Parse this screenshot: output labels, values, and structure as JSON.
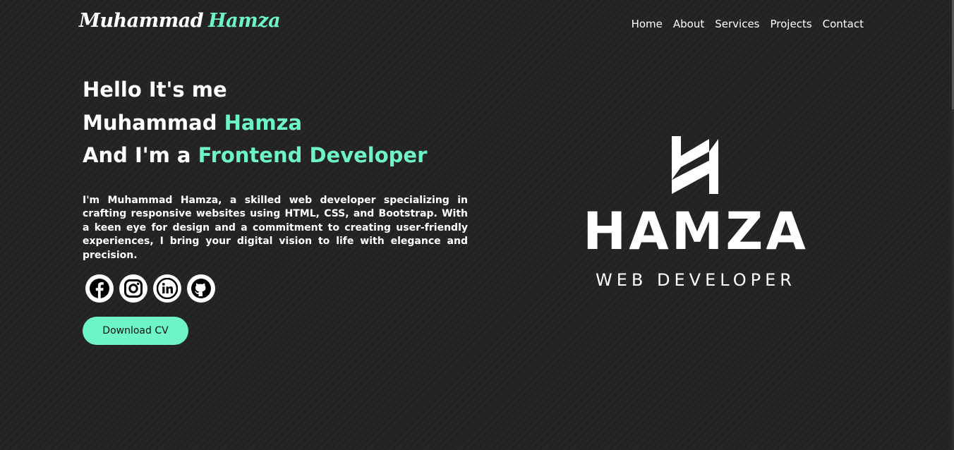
{
  "brand": {
    "first": "Muhammad",
    "second": "Hamza"
  },
  "nav": {
    "items": [
      "Home",
      "About",
      "Services",
      "Projects",
      "Contact"
    ]
  },
  "hero": {
    "greeting": "Hello It's me",
    "name_first": "Muhammad",
    "name_last": "Hamza",
    "role_prefix": "And I'm a",
    "role": "Frontend Developer",
    "bio": "I'm Muhammad Hamza, a skilled web developer specializing in crafting responsive websites using HTML, CSS, and Bootstrap. With a keen eye for design and a commitment to creating user-friendly experiences, I bring your digital vision to life with elegance and precision.",
    "socials": [
      {
        "icon": "facebook-icon"
      },
      {
        "icon": "instagram-icon"
      },
      {
        "icon": "linkedin-icon"
      },
      {
        "icon": "github-icon"
      }
    ],
    "cv_button": "Download CV"
  },
  "logo": {
    "name": "HAMZA",
    "tagline": "WEB DEVELOPER"
  },
  "colors": {
    "accent": "#6df5c6",
    "background": "#232323",
    "text": "#ffffff"
  }
}
